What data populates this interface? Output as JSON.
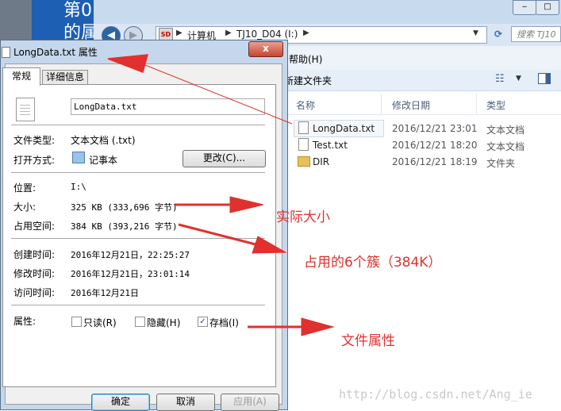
{
  "background_slide": {
    "title_fragment": "第0\n的属"
  },
  "explorer": {
    "breadcrumb": [
      "计算机",
      "TJ10_D04 (I:)"
    ],
    "search_placeholder": "搜索 TJ10",
    "menu_help": "帮助(H)",
    "new_folder": "新建文件夹",
    "columns": {
      "name": "名称",
      "modified": "修改日期",
      "type": "类型"
    },
    "files": [
      {
        "name": "LongData.txt",
        "modified": "2016/12/21 23:01",
        "type": "文本文档",
        "icon": "text-file-icon"
      },
      {
        "name": "Test.txt",
        "modified": "2016/12/21 18:20",
        "type": "文本文档",
        "icon": "text-file-icon"
      },
      {
        "name": "DIR",
        "modified": "2016/12/21 18:19",
        "type": "文件夹",
        "icon": "folder-icon"
      }
    ]
  },
  "dialog": {
    "title": "LongData.txt 属性",
    "close_label": "x",
    "tabs": [
      "常规",
      "详细信息"
    ],
    "filename": "LongData.txt",
    "rows": {
      "file_type_label": "文件类型:",
      "file_type": "文本文档 (.txt)",
      "open_with_label": "打开方式:",
      "open_with": "记事本",
      "change_button": "更改(C)...",
      "location_label": "位置:",
      "location": "I:\\",
      "size_label": "大小:",
      "size": "325 KB (333,696 字节)",
      "disk_size_label": "占用空间:",
      "disk_size": "384 KB (393,216 字节)",
      "created_label": "创建时间:",
      "created": "2016年12月21日，22:25:27",
      "modified_label": "修改时间:",
      "modified": "2016年12月21日，23:01:14",
      "accessed_label": "访问时间:",
      "accessed": "2016年12月21日",
      "attributes_label": "属性:"
    },
    "attributes": [
      {
        "label": "只读(R)",
        "checked": false
      },
      {
        "label": "隐藏(H)",
        "checked": false
      },
      {
        "label": "存档(I)",
        "checked": true
      }
    ],
    "buttons": {
      "ok": "确定",
      "cancel": "取消",
      "apply": "应用(A)"
    }
  },
  "annotations": {
    "actual_size": "实际大小",
    "clusters": "占用的6个簇（384K）",
    "file_attributes": "文件属性",
    "color": "#e0312e"
  },
  "watermark": "http://blog.csdn.net/Ang_ie"
}
